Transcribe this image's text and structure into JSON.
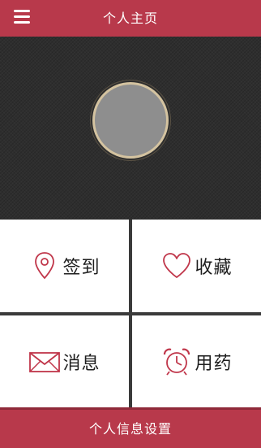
{
  "header": {
    "title": "个人主页",
    "menu_icon": "hamburger-menu-icon"
  },
  "profile": {
    "avatar_icon": "avatar"
  },
  "grid": {
    "items": [
      {
        "label": "签到",
        "icon": "location-pin-icon"
      },
      {
        "label": "收藏",
        "icon": "heart-icon"
      },
      {
        "label": "消息",
        "icon": "envelope-icon"
      },
      {
        "label": "用药",
        "icon": "alarm-clock-icon"
      }
    ]
  },
  "footer": {
    "settings_label": "个人信息设置"
  },
  "colors": {
    "accent": "#b8394b",
    "icon_stroke": "#c0364a",
    "avatar_ring": "#d4c3a0",
    "avatar_fill": "#8e8e8e",
    "background": "#2f2f2f"
  }
}
